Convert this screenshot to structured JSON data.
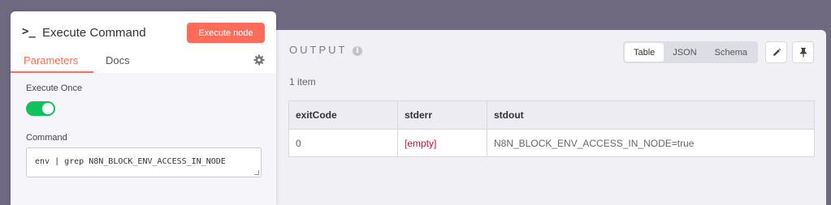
{
  "node": {
    "icon": "terminal-icon",
    "title": "Execute Command",
    "execute_label": "Execute node",
    "tabs": [
      {
        "label": "Parameters",
        "active": true
      },
      {
        "label": "Docs",
        "active": false
      }
    ],
    "settings_icon": "gear-icon",
    "params": {
      "execute_once_label": "Execute Once",
      "execute_once_value": true,
      "command_label": "Command",
      "command_value": "env | grep N8N_BLOCK_ENV_ACCESS_IN_NODE"
    }
  },
  "output": {
    "title": "OUTPUT",
    "info_icon": "info-icon",
    "view_options": [
      "Table",
      "JSON",
      "Schema"
    ],
    "active_view": "Table",
    "edit_icon": "pencil-icon",
    "pin_icon": "pin-icon",
    "items_count": "1 item",
    "columns": [
      "exitCode",
      "stderr",
      "stdout"
    ],
    "rows": [
      [
        "0",
        "[empty]",
        "N8N_BLOCK_ENV_ACCESS_IN_NODE=true"
      ]
    ]
  },
  "colors": {
    "accent": "#ff6d5a",
    "toggle_on": "#13c15c",
    "empty_text": "#d0102a",
    "backdrop": "#6f6a80"
  }
}
